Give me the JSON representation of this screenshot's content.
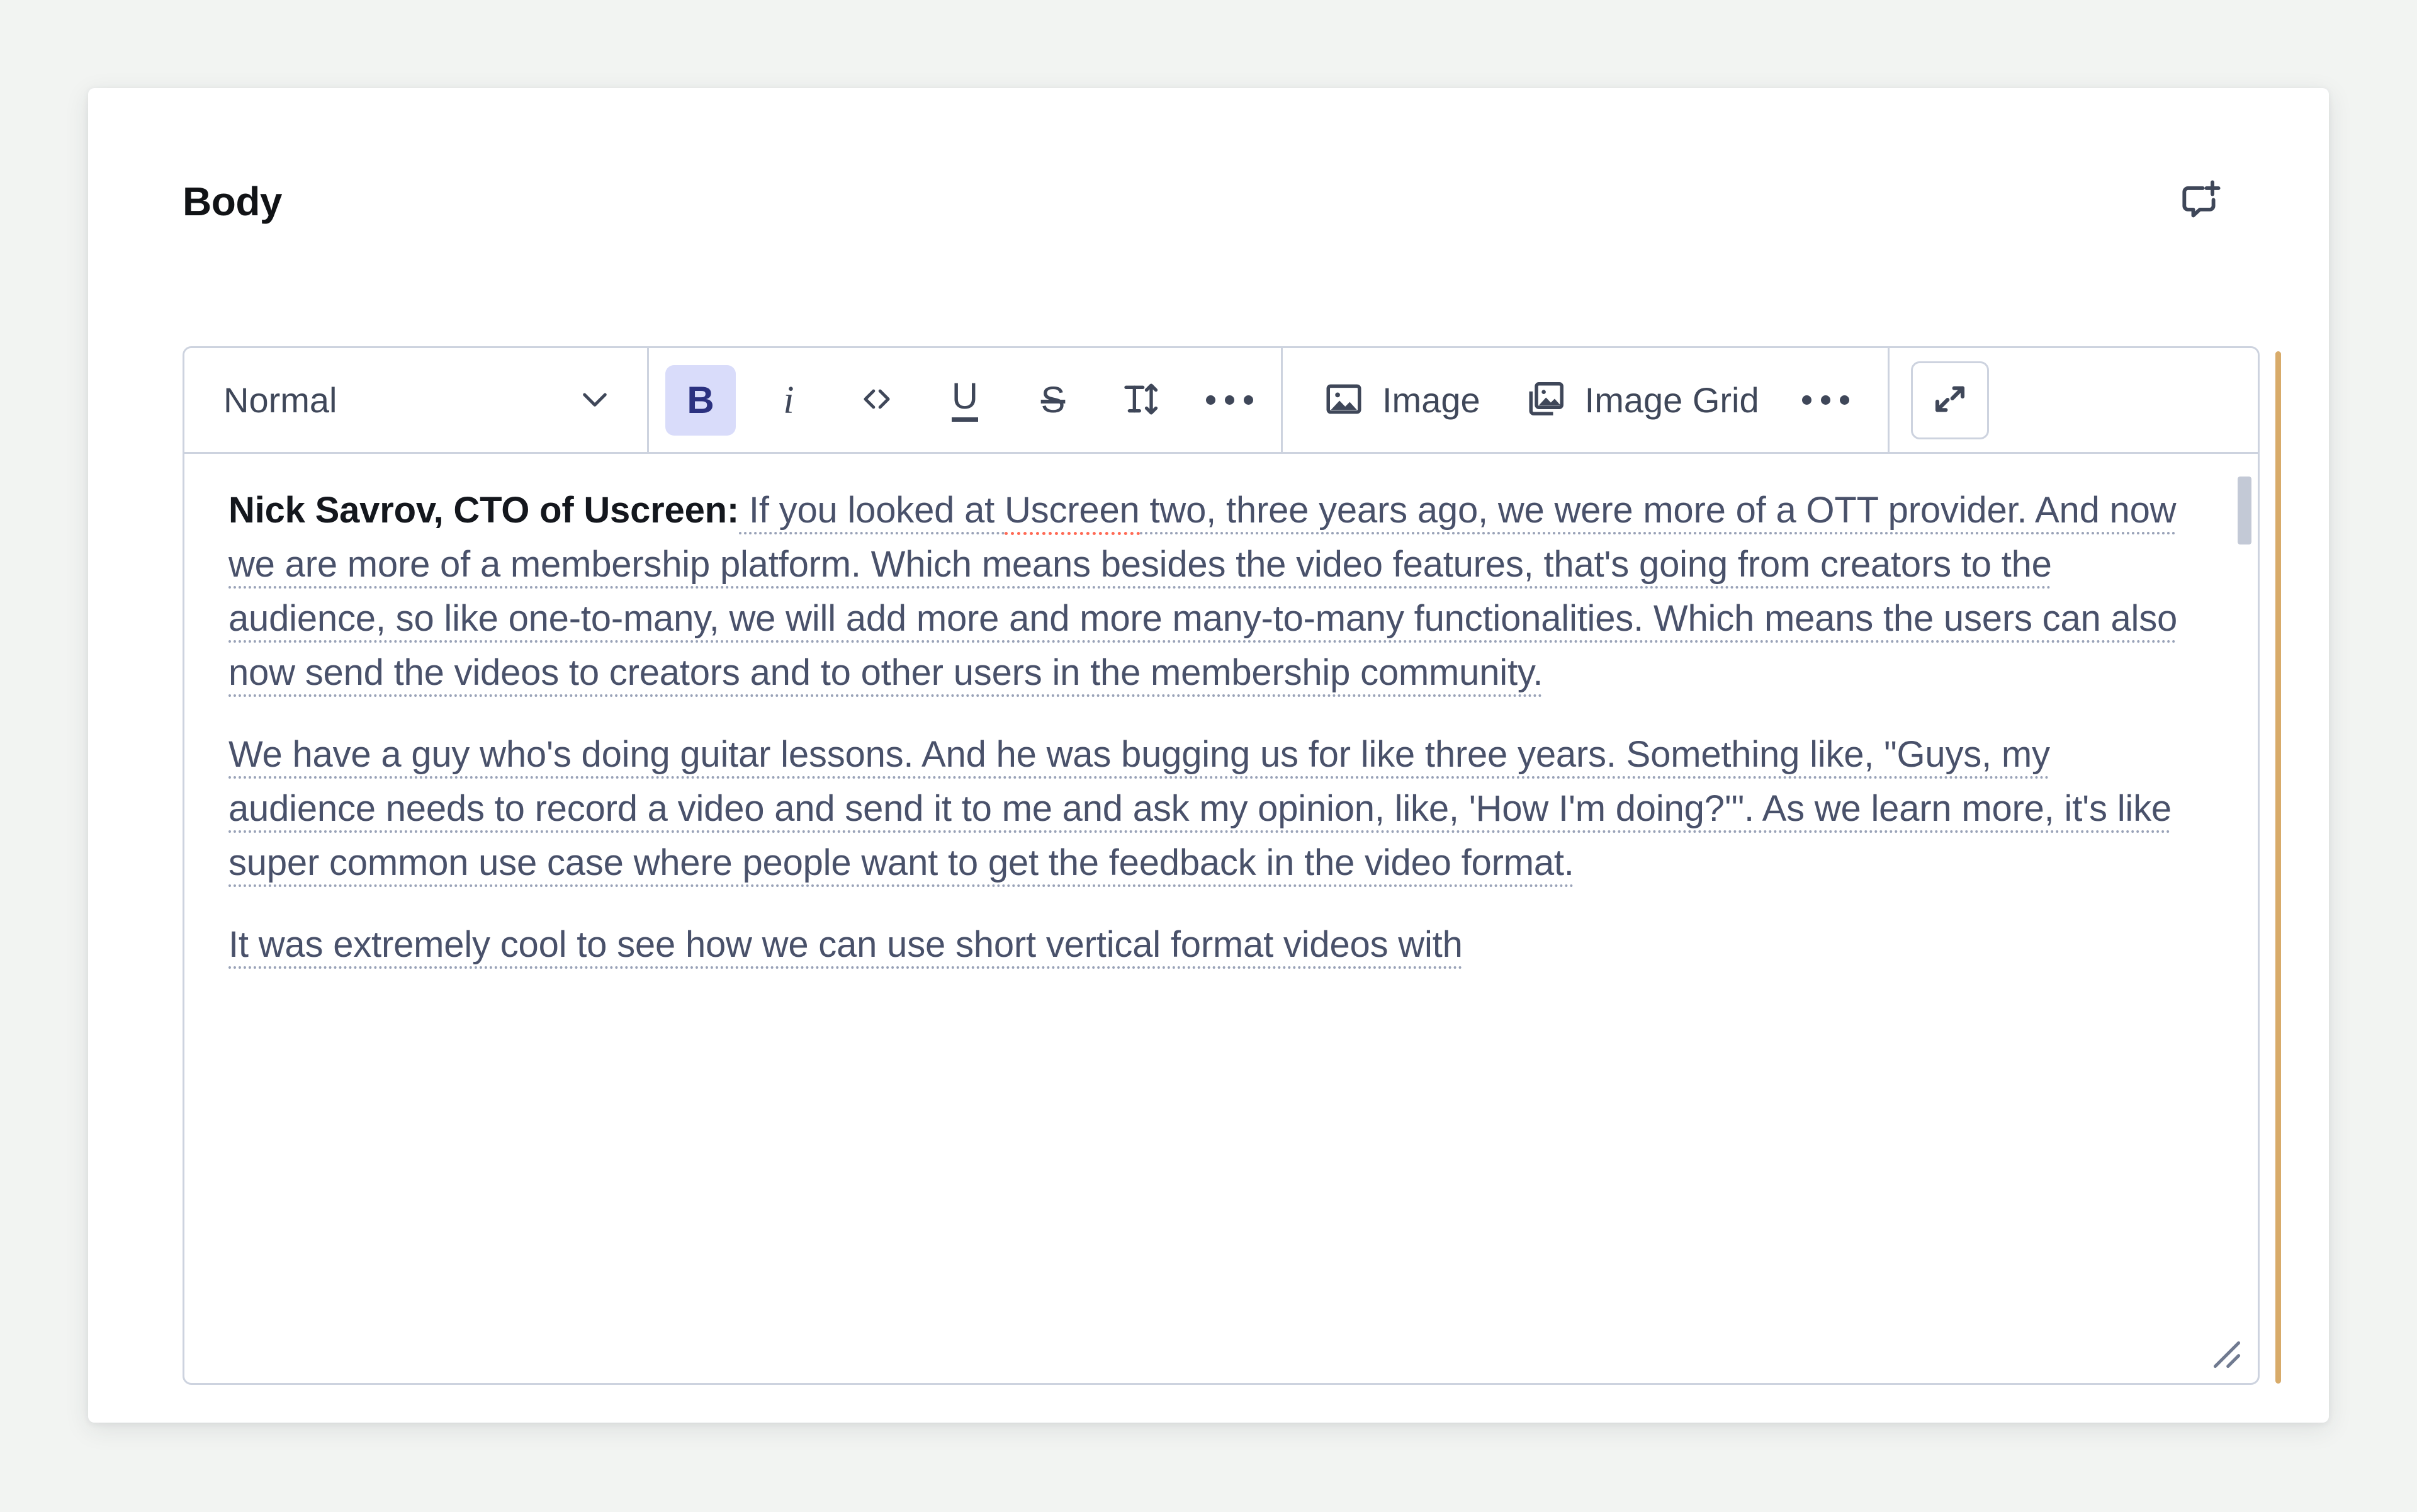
{
  "card": {
    "title": "Body"
  },
  "header": {
    "add_comment_icon": "comment-plus-icon",
    "add_comment_title": "Add comment"
  },
  "toolbar": {
    "style_select": {
      "value": "Normal",
      "chevron_icon": "chevron-down-icon"
    },
    "format_buttons": [
      {
        "name": "bold",
        "glyph": "B",
        "active": true,
        "icon": "bold-icon"
      },
      {
        "name": "italic",
        "glyph": "i",
        "active": false,
        "icon": "italic-icon"
      },
      {
        "name": "code",
        "glyph": "<>",
        "active": false,
        "icon": "code-icon"
      },
      {
        "name": "underline",
        "glyph": "U",
        "active": false,
        "icon": "underline-icon"
      },
      {
        "name": "strikethrough",
        "glyph": "S",
        "active": false,
        "icon": "strikethrough-icon"
      },
      {
        "name": "text-size",
        "glyph": "T↕",
        "active": false,
        "icon": "text-size-icon"
      },
      {
        "name": "more-format",
        "glyph": "···",
        "active": false,
        "icon": "ellipsis-icon"
      }
    ],
    "insert_buttons": [
      {
        "label": "Image",
        "icon": "image-icon"
      },
      {
        "label": "Image Grid",
        "icon": "image-grid-icon"
      }
    ],
    "more_insert_icon": "ellipsis-icon",
    "expand_icon": "expand-diagonal-icon",
    "expand_title": "Expand editor"
  },
  "document": {
    "paragraphs": [
      {
        "speaker": "Nick Savrov, CTO of Uscreen:",
        "before_misspelling": " If you looked at ",
        "misspelled_word": "Uscreen",
        "after_misspelling": " two, three years ago, we were more of a OTT provider. And now we are more of a membership platform. Which means besides the video features, that's going from creators to the audience, so like one-to-many, we will add more and more many-to-many functionalities. Which means the users can also now send the videos to creators and to other users in the membership community."
      },
      {
        "text": "We have a guy who's doing guitar lessons. And he was bugging us for like three years. Something like, \"Guys, my audience needs to record a video and send it to me and ask my opinion, like, 'How I'm doing?'\". As we learn more, it's like super common use case where people want to get the feedback in the video format."
      },
      {
        "text": "It was extremely cool to see how we can use short vertical format videos with"
      }
    ]
  },
  "colors": {
    "page_background": "#f2f4f2",
    "card_background": "#ffffff",
    "border": "#cdd3df",
    "text_body": "#49516a",
    "text_strong": "#14171d",
    "active_button_bg": "#d9dcfa",
    "active_button_fg": "#2b3180",
    "accent_bar": "#d8ab6a",
    "spellcheck_underline": "#ff6a55",
    "dotted_underline": "#9aa3b8",
    "scrollbar_thumb": "#c3c9d6"
  }
}
